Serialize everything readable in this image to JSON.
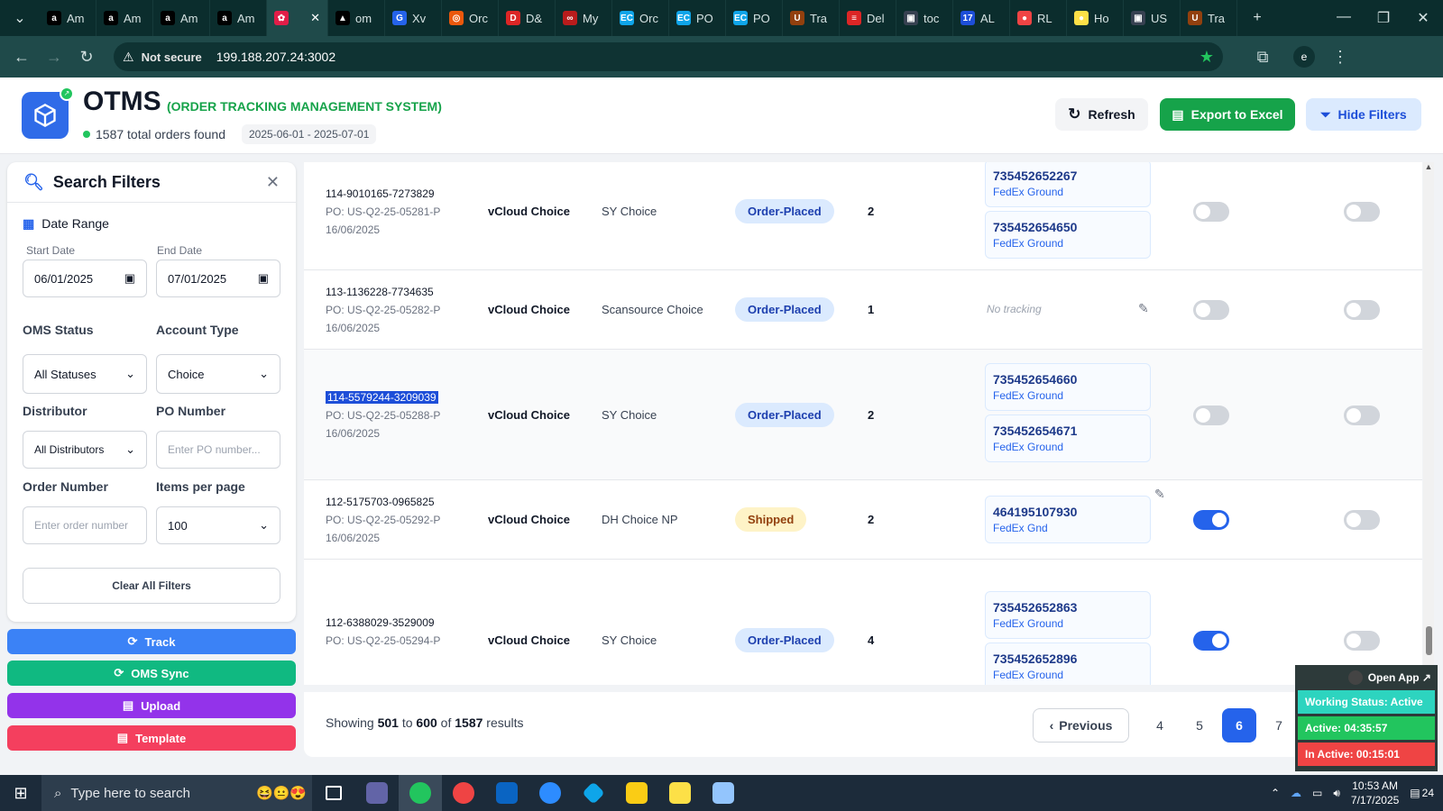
{
  "browser": {
    "tabs": [
      {
        "label": "Am",
        "color": "#000000",
        "glyph": "a"
      },
      {
        "label": "Am",
        "color": "#000000",
        "glyph": "a"
      },
      {
        "label": "Am",
        "color": "#000000",
        "glyph": "a"
      },
      {
        "label": "Am",
        "color": "#000000",
        "glyph": "a"
      },
      {
        "label": "",
        "color": "#e11d48",
        "glyph": "✿",
        "active": true
      },
      {
        "label": "om",
        "color": "#000000",
        "glyph": "▲"
      },
      {
        "label": "Xv",
        "color": "#2563eb",
        "glyph": "G"
      },
      {
        "label": "Orc",
        "color": "#ea580c",
        "glyph": "◎"
      },
      {
        "label": "D&",
        "color": "#dc2626",
        "glyph": "D"
      },
      {
        "label": "My",
        "color": "#b91c1c",
        "glyph": "∞"
      },
      {
        "label": "Orc",
        "color": "#0ea5e9",
        "glyph": "EC"
      },
      {
        "label": "PO",
        "color": "#0ea5e9",
        "glyph": "EC"
      },
      {
        "label": "PO",
        "color": "#0ea5e9",
        "glyph": "EC"
      },
      {
        "label": "Tra",
        "color": "#92400e",
        "glyph": "U"
      },
      {
        "label": "Del",
        "color": "#dc2626",
        "glyph": "≡"
      },
      {
        "label": "toc",
        "color": "#374151",
        "glyph": "▣"
      },
      {
        "label": "AL",
        "color": "#1d4ed8",
        "glyph": "17"
      },
      {
        "label": "RL",
        "color": "#ef4444",
        "glyph": "●"
      },
      {
        "label": "Ho",
        "color": "#fde047",
        "glyph": "●"
      },
      {
        "label": "US",
        "color": "#374151",
        "glyph": "▣"
      },
      {
        "label": "Tra",
        "color": "#92400e",
        "glyph": "U"
      }
    ],
    "url": "199.188.207.24:3002",
    "not_secure": "Not secure",
    "profile": "e"
  },
  "header": {
    "title": "OTMS",
    "subtitle": "(ORDER TRACKING MANAGEMENT SYSTEM)",
    "order_count": "1587 total orders found",
    "date_range": "2025-06-01 - 2025-07-01",
    "refresh_label": "Refresh",
    "export_label": "Export to Excel",
    "hide_filters_label": "Hide Filters"
  },
  "filters": {
    "title": "Search Filters",
    "date_range_label": "Date Range",
    "start_label": "Start Date",
    "start_value": "06/01/2025",
    "end_label": "End Date",
    "end_value": "07/01/2025",
    "oms_status_label": "OMS Status",
    "oms_status_value": "All Statuses",
    "account_type_label": "Account Type",
    "account_type_value": "Choice",
    "distributor_label": "Distributor",
    "distributor_value": "All Distributors",
    "po_label": "PO Number",
    "po_placeholder": "Enter PO number...",
    "order_label": "Order Number",
    "order_placeholder": "Enter order number",
    "items_label": "Items per page",
    "items_value": "100",
    "clear_label": "Clear All Filters"
  },
  "actions": {
    "track": "Track",
    "oms_sync": "OMS Sync",
    "upload": "Upload",
    "template": "Template"
  },
  "rows": [
    {
      "order": "114-9010165-7273829",
      "po": "PO: US-Q2-25-05281-P",
      "date": "16/06/2025",
      "account": "vCloud Choice",
      "distributor": "SY Choice",
      "status": "Order-Placed",
      "qty": "2",
      "tracking": [
        {
          "num": "735452652267",
          "carrier": "FedEx Ground"
        },
        {
          "num": "735452654650",
          "carrier": "FedEx Ground"
        }
      ],
      "toggle1": false,
      "toggle2": false
    },
    {
      "order": "113-1136228-7734635",
      "po": "PO: US-Q2-25-05282-P",
      "date": "16/06/2025",
      "account": "vCloud Choice",
      "distributor": "Scansource Choice",
      "status": "Order-Placed",
      "qty": "1",
      "no_tracking": "No tracking",
      "toggle1": false,
      "toggle2": false
    },
    {
      "order": "114-5579244-3209039",
      "po": "PO: US-Q2-25-05288-P",
      "date": "16/06/2025",
      "account": "vCloud Choice",
      "distributor": "SY Choice",
      "status": "Order-Placed",
      "qty": "2",
      "tracking": [
        {
          "num": "735452654660",
          "carrier": "FedEx Ground"
        },
        {
          "num": "735452654671",
          "carrier": "FedEx Ground"
        }
      ],
      "toggle1": false,
      "toggle2": false
    },
    {
      "order": "112-5175703-0965825",
      "po": "PO: US-Q2-25-05292-P",
      "date": "16/06/2025",
      "account": "vCloud Choice",
      "distributor": "DH Choice NP",
      "status": "Shipped",
      "qty": "2",
      "tracking": [
        {
          "num": "464195107930",
          "carrier": "FedEx Gnd"
        }
      ],
      "toggle1": true,
      "toggle2": false
    },
    {
      "order": "112-6388029-3529009",
      "po": "PO: US-Q2-25-05294-P",
      "date": "",
      "account": "vCloud Choice",
      "distributor": "SY Choice",
      "status": "Order-Placed",
      "qty": "4",
      "tracking": [
        {
          "num": "735452652863",
          "carrier": "FedEx Ground"
        },
        {
          "num": "735452652896",
          "carrier": "FedEx Ground"
        }
      ],
      "toggle1": true,
      "toggle2": false
    }
  ],
  "pagination": {
    "showing_prefix": "Showing",
    "from": "501",
    "to_word": "to",
    "to": "600",
    "of_word": "of",
    "total": "1587",
    "suffix": "results",
    "prev_label": "Previous",
    "pages": [
      "4",
      "5",
      "6",
      "7"
    ],
    "current": "6"
  },
  "widget": {
    "open_app": "Open App ↗",
    "working_status": "Working Status: Active",
    "active": "Active: 04:35:57",
    "inactive": "In Active: 00:15:01"
  },
  "taskbar": {
    "search_placeholder": "Type here to search",
    "time": "10:53 AM",
    "date": "7/17/2025",
    "notifications": "24"
  },
  "colors": {
    "primary": "#2563eb",
    "green": "#16a34a",
    "track": "#3b82f6",
    "sync": "#10b981",
    "upload": "#9333ea",
    "template": "#f43f5e"
  }
}
